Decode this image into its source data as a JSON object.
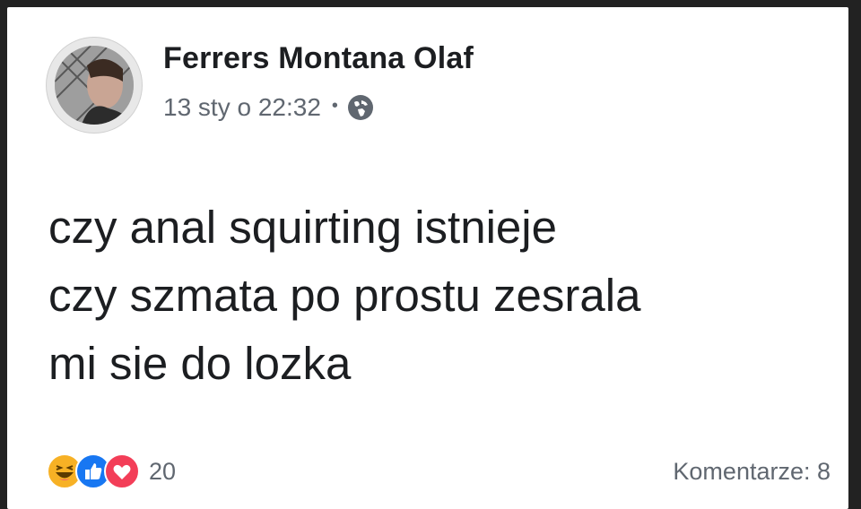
{
  "post": {
    "author": "Ferrers Montana Olaf",
    "timestamp": "13 sty o 22:32",
    "separator": "•",
    "privacy_icon": "globe-icon",
    "text_lines": [
      "czy anal squirting istnieje",
      "czy szmata po prostu zesrala",
      "mi sie do lozka"
    ]
  },
  "footer": {
    "reactions": [
      "haha-icon",
      "like-icon",
      "love-icon"
    ],
    "reaction_count": "20",
    "comments_label": "Komentarze: 8"
  },
  "colors": {
    "like": "#1877f2",
    "love": "#f33e58",
    "haha": "#f7b125",
    "text": "#1c1e21",
    "meta": "#606770"
  }
}
